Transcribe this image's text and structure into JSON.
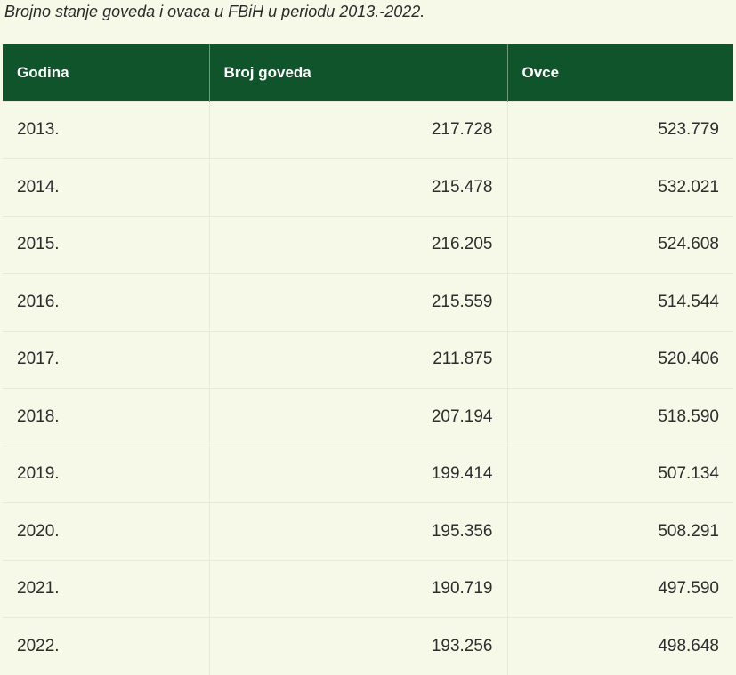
{
  "caption": "Brojno stanje goveda i ovaca u FBiH u periodu 2013.-2022.",
  "table": {
    "headers": [
      "Godina",
      "Broj goveda",
      "Ovce"
    ],
    "rows": [
      {
        "year": "2013.",
        "cattle": "217.728",
        "sheep": "523.779"
      },
      {
        "year": "2014.",
        "cattle": "215.478",
        "sheep": "532.021"
      },
      {
        "year": "2015.",
        "cattle": "216.205",
        "sheep": "524.608"
      },
      {
        "year": "2016.",
        "cattle": "215.559",
        "sheep": "514.544"
      },
      {
        "year": "2017.",
        "cattle": "211.875",
        "sheep": "520.406"
      },
      {
        "year": "2018.",
        "cattle": "207.194",
        "sheep": "518.590"
      },
      {
        "year": "2019.",
        "cattle": "199.414",
        "sheep": "507.134"
      },
      {
        "year": "2020.",
        "cattle": "195.356",
        "sheep": "508.291"
      },
      {
        "year": "2021.",
        "cattle": "190.719",
        "sheep": "497.590"
      },
      {
        "year": "2022.",
        "cattle": "193.256",
        "sheep": "498.648"
      }
    ]
  }
}
